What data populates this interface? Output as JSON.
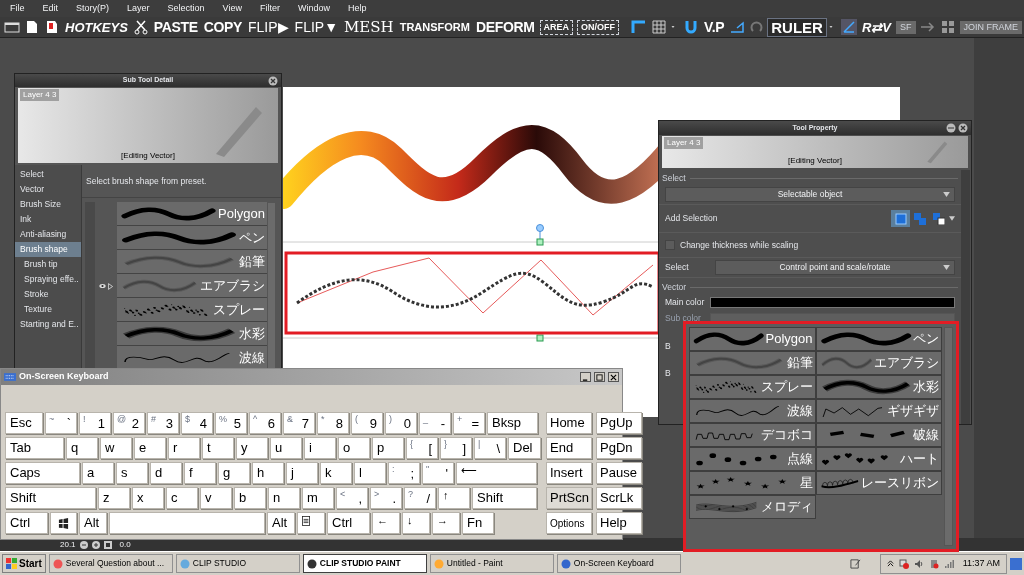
{
  "menu": [
    "File",
    "Edit",
    "Story(P)",
    "Layer",
    "Selection",
    "View",
    "Filter",
    "Window",
    "Help"
  ],
  "toolbar": [
    {
      "label": "HOTKEYS",
      "kind": "italic"
    },
    {
      "label": "PASTE",
      "kind": "bold"
    },
    {
      "label": "COPY",
      "kind": "bold"
    },
    {
      "label": "FLIP▶",
      "kind": "plain"
    },
    {
      "label": "FLIP▼",
      "kind": "plain"
    },
    {
      "label": "MESH",
      "kind": "serif"
    },
    {
      "label": "TRANSFORM",
      "kind": "small"
    },
    {
      "label": "DEFORM",
      "kind": "bold"
    },
    {
      "label": "AREA",
      "kind": "dashed"
    },
    {
      "label": "ON/OFF",
      "kind": "dashed"
    },
    {
      "label": "V.P",
      "kind": "bold"
    },
    {
      "label": "RULER",
      "kind": "framed"
    },
    {
      "label": "R⇄V",
      "kind": "italic"
    },
    {
      "label": "SF",
      "kind": "muted"
    },
    {
      "label": "JOIN FRAME",
      "kind": "muted"
    }
  ],
  "sub_tool_detail": {
    "title": "Sub Tool Detail",
    "layer": "Layer 4 3",
    "mode": "[Editing Vector]",
    "hint": "Select brush shape from preset.",
    "categories": [
      {
        "label": "Select",
        "selected": false
      },
      {
        "label": "Vector",
        "selected": false
      },
      {
        "label": "Brush Size",
        "selected": false
      },
      {
        "label": "Ink",
        "selected": false
      },
      {
        "label": "Anti-aliasing",
        "selected": false
      },
      {
        "label": "Brush shape",
        "selected": true,
        "children": [
          {
            "label": "Brush tip",
            "selected": false
          },
          {
            "label": "Spraying effe..",
            "selected": false
          },
          {
            "label": "Stroke",
            "selected": false
          },
          {
            "label": "Texture",
            "selected": false
          }
        ]
      },
      {
        "label": "Starting and E..",
        "selected": false
      }
    ],
    "presets": [
      {
        "label": "Polygon",
        "kind": "solid"
      },
      {
        "label": "ペン",
        "kind": "solid"
      },
      {
        "label": "鉛筆",
        "kind": "soft"
      },
      {
        "label": "エアブラシ",
        "kind": "soft"
      },
      {
        "label": "スプレー",
        "kind": "spray"
      },
      {
        "label": "水彩",
        "kind": "blur"
      },
      {
        "label": "波線",
        "kind": "wave"
      }
    ]
  },
  "tool_property": {
    "title": "Tool Property",
    "layer": "Layer 4 3",
    "mode": "[Editing Vector]",
    "rows": [
      {
        "kind": "section",
        "label": "Select"
      },
      {
        "kind": "dropdown",
        "value": "Selectable object"
      },
      {
        "kind": "buttons",
        "label": "Add Selection",
        "options": [
          {
            "selected": true
          },
          {
            "selected": false
          },
          {
            "selected": false
          }
        ]
      },
      {
        "kind": "checkbox",
        "label": "Change thickness while scaling",
        "checked": false
      },
      {
        "kind": "dropdown",
        "label": "Select",
        "value": "Control point and scale/rotate"
      },
      {
        "kind": "section",
        "label": "Vector"
      },
      {
        "kind": "color",
        "label": "Main color",
        "color": "#000000",
        "disabled": false
      },
      {
        "kind": "color",
        "label": "Sub color",
        "disabled": true
      },
      {
        "kind": "label",
        "label": "B"
      },
      {
        "kind": "label",
        "label": "B"
      }
    ]
  },
  "brush_popup": [
    {
      "label": "Polygon",
      "kind": "solid"
    },
    {
      "label": "ペン",
      "kind": "solid"
    },
    {
      "label": "鉛筆",
      "kind": "soft"
    },
    {
      "label": "エアブラシ",
      "kind": "soft"
    },
    {
      "label": "スプレー",
      "kind": "spray"
    },
    {
      "label": "水彩",
      "kind": "blur"
    },
    {
      "label": "波線",
      "kind": "wave"
    },
    {
      "label": "ギザギザ",
      "kind": "zigzag"
    },
    {
      "label": "デコボコ",
      "kind": "bumpy"
    },
    {
      "label": "破線",
      "kind": "dash"
    },
    {
      "label": "点線",
      "kind": "dots"
    },
    {
      "label": "ハート",
      "kind": "hearts"
    },
    {
      "label": "星",
      "kind": "stars"
    },
    {
      "label": "レースリボン",
      "kind": "lace"
    },
    {
      "label": "メロディ",
      "kind": "melody"
    }
  ],
  "keyboard": {
    "title": "On-Screen Keyboard",
    "rows": [
      [
        {
          "kind": "label",
          "main": "Esc"
        },
        {
          "kind": "dual",
          "shift": "~",
          "main": "`"
        },
        {
          "kind": "dual",
          "shift": "!",
          "main": "1"
        },
        {
          "kind": "dual",
          "shift": "@",
          "main": "2"
        },
        {
          "kind": "dual",
          "shift": "#",
          "main": "3"
        },
        {
          "kind": "dual",
          "shift": "$",
          "main": "4"
        },
        {
          "kind": "dual",
          "shift": "%",
          "main": "5"
        },
        {
          "kind": "dual",
          "shift": "^",
          "main": "6"
        },
        {
          "kind": "dual",
          "shift": "&",
          "main": "7"
        },
        {
          "kind": "dual",
          "shift": "*",
          "main": "8"
        },
        {
          "kind": "dual",
          "shift": "(",
          "main": "9"
        },
        {
          "kind": "dual",
          "shift": ")",
          "main": "0"
        },
        {
          "kind": "dual",
          "shift": "_",
          "main": "-"
        },
        {
          "kind": "dual",
          "shift": "+",
          "main": "="
        },
        {
          "kind": "label",
          "main": "Bksp"
        }
      ],
      [
        {
          "kind": "label",
          "main": "Tab"
        },
        {
          "kind": "label",
          "main": "q"
        },
        {
          "kind": "label",
          "main": "w"
        },
        {
          "kind": "label",
          "main": "e"
        },
        {
          "kind": "label",
          "main": "r"
        },
        {
          "kind": "label",
          "main": "t"
        },
        {
          "kind": "label",
          "main": "y"
        },
        {
          "kind": "label",
          "main": "u"
        },
        {
          "kind": "label",
          "main": "i"
        },
        {
          "kind": "label",
          "main": "o"
        },
        {
          "kind": "label",
          "main": "p"
        },
        {
          "kind": "dual",
          "shift": "{",
          "main": "["
        },
        {
          "kind": "dual",
          "shift": "}",
          "main": "]"
        },
        {
          "kind": "dual",
          "shift": "|",
          "main": "\\"
        },
        {
          "kind": "label",
          "main": "Del"
        }
      ],
      [
        {
          "kind": "label",
          "main": "Caps"
        },
        {
          "kind": "label",
          "main": "a"
        },
        {
          "kind": "label",
          "main": "s"
        },
        {
          "kind": "label",
          "main": "d"
        },
        {
          "kind": "label",
          "main": "f"
        },
        {
          "kind": "label",
          "main": "g"
        },
        {
          "kind": "label",
          "main": "h"
        },
        {
          "kind": "label",
          "main": "j"
        },
        {
          "kind": "label",
          "main": "k"
        },
        {
          "kind": "label",
          "main": "l"
        },
        {
          "kind": "dual",
          "shift": ":",
          "main": ";"
        },
        {
          "kind": "dual",
          "shift": "\"",
          "main": "'"
        },
        {
          "kind": "arrow",
          "main": "⟵"
        }
      ],
      [
        {
          "kind": "label",
          "main": "Shift"
        },
        {
          "kind": "label",
          "main": "z"
        },
        {
          "kind": "label",
          "main": "x"
        },
        {
          "kind": "label",
          "main": "c"
        },
        {
          "kind": "label",
          "main": "v"
        },
        {
          "kind": "label",
          "main": "b"
        },
        {
          "kind": "label",
          "main": "n"
        },
        {
          "kind": "label",
          "main": "m"
        },
        {
          "kind": "dual",
          "shift": "<",
          "main": ","
        },
        {
          "kind": "dual",
          "shift": ">",
          "main": "."
        },
        {
          "kind": "dual",
          "shift": "?",
          "main": "/"
        },
        {
          "kind": "arrow",
          "main": "↑"
        },
        {
          "kind": "label",
          "main": "Shift"
        }
      ],
      [
        {
          "kind": "label",
          "main": "Ctrl"
        },
        {
          "kind": "logo"
        },
        {
          "kind": "label",
          "main": "Alt"
        },
        {
          "kind": "space"
        },
        {
          "kind": "label",
          "main": "Alt"
        },
        {
          "kind": "menu"
        },
        {
          "kind": "label",
          "main": "Ctrl"
        },
        {
          "kind": "arrow",
          "main": "←"
        },
        {
          "kind": "arrow",
          "main": "↓"
        },
        {
          "kind": "arrow",
          "main": "→"
        },
        {
          "kind": "label",
          "main": "Fn"
        }
      ]
    ],
    "nav": [
      [
        {
          "main": "Home",
          "pressed": false
        },
        {
          "main": "PgUp",
          "pressed": false
        }
      ],
      [
        {
          "main": "End",
          "pressed": false
        },
        {
          "main": "PgDn",
          "pressed": false
        }
      ],
      [
        {
          "main": "Insert",
          "pressed": false
        },
        {
          "main": "Pause",
          "pressed": false
        }
      ],
      [
        {
          "main": "PrtScn",
          "pressed": true
        },
        {
          "main": "ScrLk",
          "pressed": false
        }
      ],
      [
        {
          "main": "Options",
          "pressed": false
        },
        {
          "main": "Help",
          "pressed": false
        }
      ]
    ]
  },
  "status_bar": {
    "zoom": "20.1",
    "angle": "0.0"
  },
  "taskbar": {
    "start": "Start",
    "items": [
      {
        "label": "Several Question about ...",
        "selected": false
      },
      {
        "label": "CLIP STUDIO",
        "selected": false
      },
      {
        "label": "CLIP STUDIO PAINT",
        "selected": true
      },
      {
        "label": "Untitled - Paint",
        "selected": false
      },
      {
        "label": "On-Screen Keyboard",
        "selected": false
      }
    ],
    "time": "11:37 AM"
  }
}
